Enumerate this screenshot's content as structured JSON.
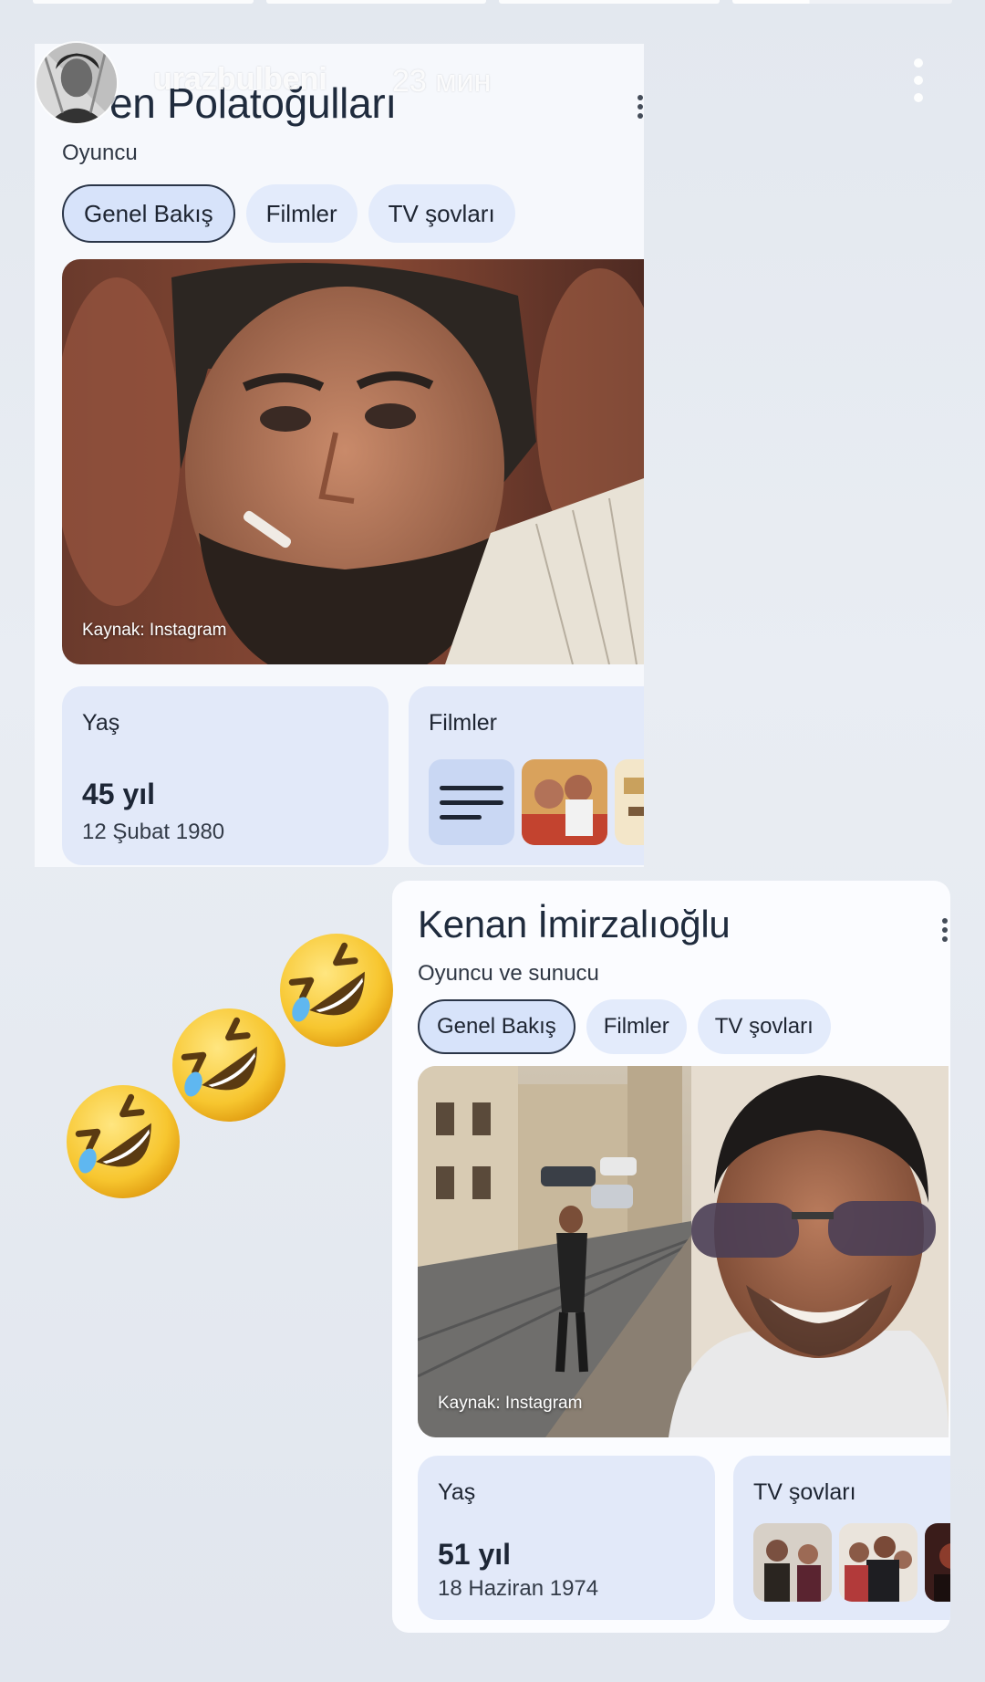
{
  "story": {
    "username": "urazbulbeni",
    "time": "23 мин",
    "menu_icon": "more-vertical-icon"
  },
  "card1": {
    "title": "en Polatoğulları",
    "subtitle": "Oyuncu",
    "tabs": [
      {
        "label": "Genel Bakış",
        "active": true
      },
      {
        "label": "Filmler",
        "active": false
      },
      {
        "label": "TV şovları",
        "active": false
      }
    ],
    "photo_credit": "Kaynak: Instagram",
    "age": {
      "label": "Yaş",
      "value": "45 yıl",
      "birthdate": "12 Şubat 1980"
    },
    "films": {
      "label": "Filmler"
    }
  },
  "card2": {
    "title": "Kenan İmirzalıoğlu",
    "subtitle": "Oyuncu ve sunucu",
    "tabs": [
      {
        "label": "Genel Bakış",
        "active": true
      },
      {
        "label": "Filmler",
        "active": false
      },
      {
        "label": "TV şovları",
        "active": false
      }
    ],
    "photo_credit": "Kaynak: Instagram",
    "age": {
      "label": "Yaş",
      "value": "51 yıl",
      "birthdate": "18 Haziran 1974"
    },
    "tv": {
      "label": "TV şovları"
    }
  },
  "stickers": [
    "rolling-on-floor-laughing-emoji",
    "rolling-on-floor-laughing-emoji",
    "rolling-on-floor-laughing-emoji"
  ],
  "colors": {
    "chip_bg": "#e3ebfb",
    "chip_active_border": "#2a3548",
    "tile_bg": "#e2e9f9"
  }
}
